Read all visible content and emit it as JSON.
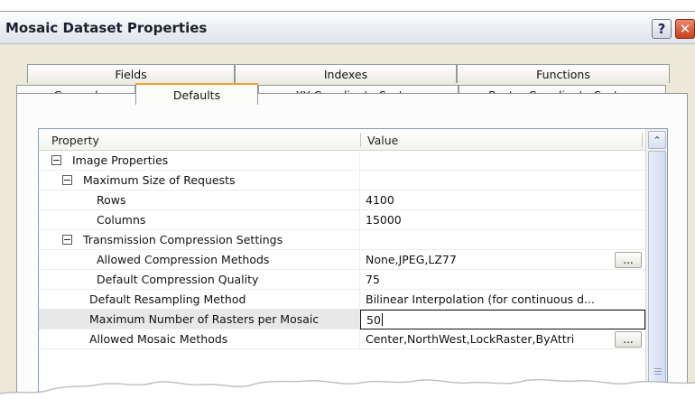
{
  "window": {
    "title": "Mosaic Dataset Properties",
    "help_label": "?",
    "close_label": "✕"
  },
  "tabs_back": [
    "Fields",
    "Indexes",
    "Functions"
  ],
  "tabs_front": [
    "General",
    "Defaults",
    "XY Coordinate System",
    "Raster Coordinate System"
  ],
  "active_tab": "Defaults",
  "grid": {
    "col_property": "Property",
    "col_value": "Value",
    "rows": [
      {
        "label": "Image Properties",
        "value": "",
        "expander": "−"
      },
      {
        "label": "Maximum Size of Requests",
        "value": "",
        "expander": "−"
      },
      {
        "label": "Rows",
        "value": "4100"
      },
      {
        "label": "Columns",
        "value": "15000"
      },
      {
        "label": "Transmission Compression Settings",
        "value": "",
        "expander": "−"
      },
      {
        "label": "Allowed Compression Methods",
        "value": "None,JPEG,LZ77",
        "button": "..."
      },
      {
        "label": "Default Compression Quality",
        "value": "75"
      },
      {
        "label": "Default Resampling Method",
        "value": "Bilinear Interpolation (for continuous d..."
      },
      {
        "label": "Maximum Number of Rasters per Mosaic",
        "value": "50"
      },
      {
        "label": "Allowed Mosaic Methods",
        "value": "Center,NorthWest,LockRaster,ByAttri",
        "button": "..."
      }
    ]
  },
  "scrollbar": {
    "up_arrow": "⌃"
  },
  "colors": {
    "tab_active_accent": "#f0a22c",
    "selected_row": "#e8e8e8",
    "close_button": "#c8401e"
  }
}
